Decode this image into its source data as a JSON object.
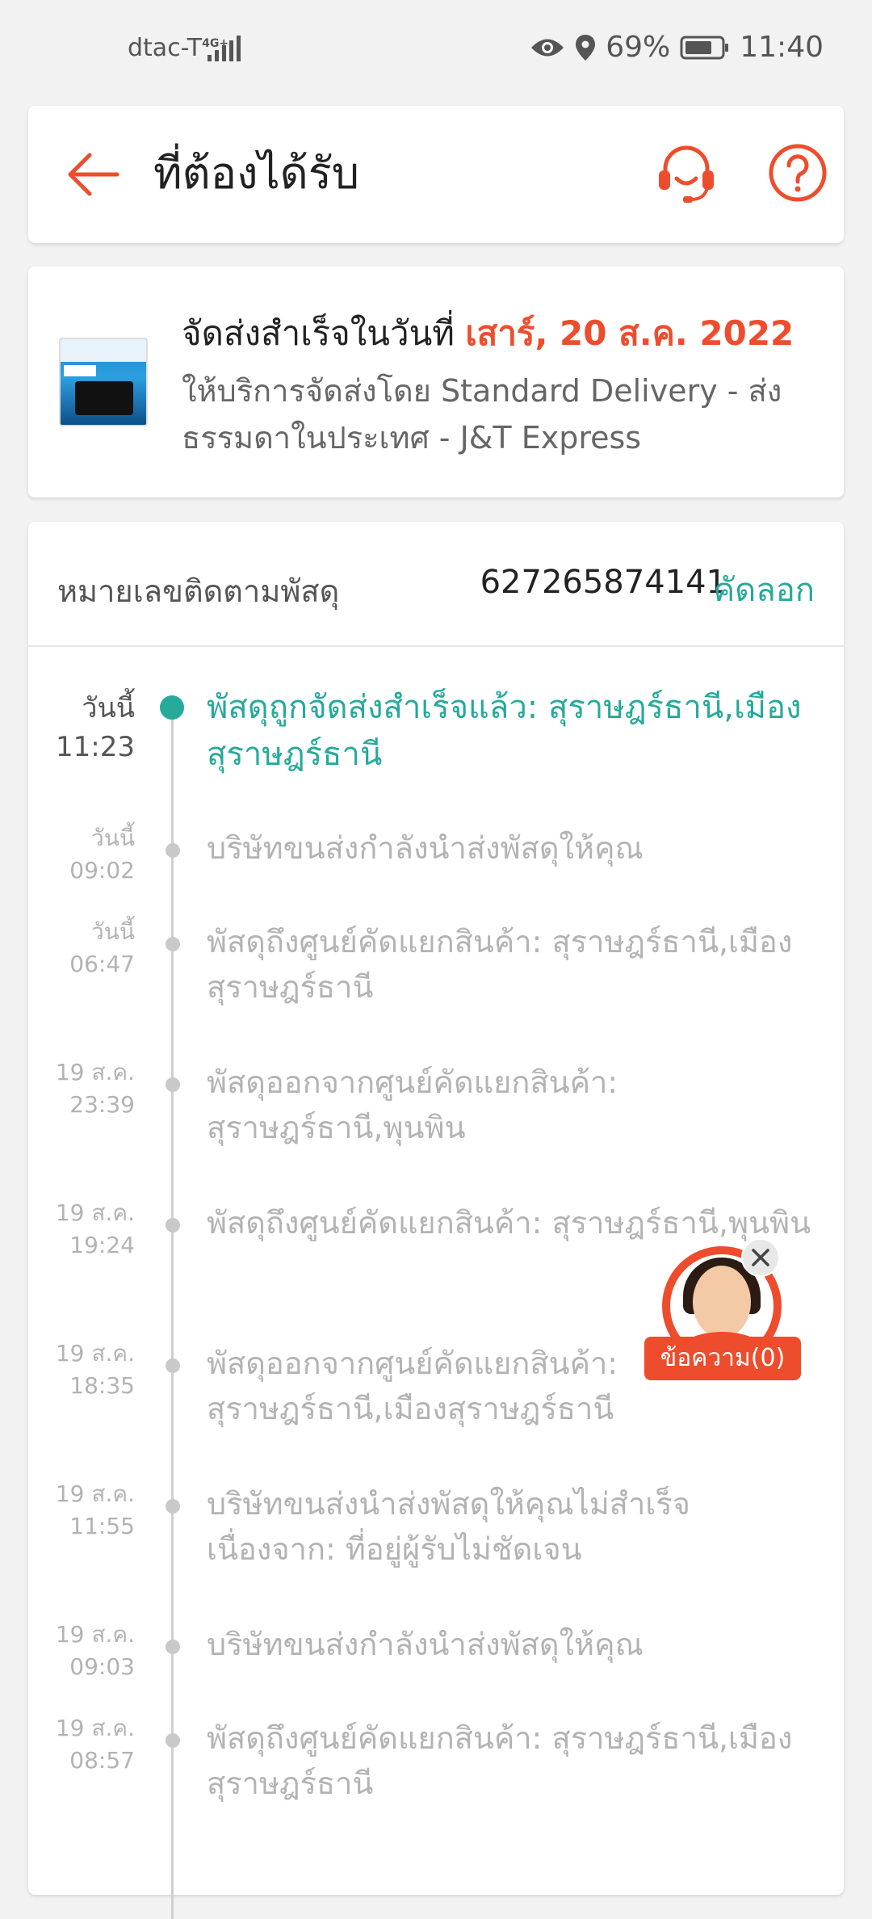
{
  "status_bar": {
    "carrier": "dtac-T",
    "network": "4G+",
    "battery": "69%",
    "time": "11:40",
    "icons": [
      "eye-icon",
      "location-icon",
      "battery-icon",
      "signal-icon"
    ]
  },
  "header": {
    "title": "ที่ต้องได้รับ",
    "back_icon": "back-arrow-icon",
    "support_icon": "headset-icon",
    "help_icon": "help-icon"
  },
  "delivery": {
    "status_prefix": "จัดส่งสำเร็จในวันที่ ",
    "date": "เสาร์, 20 ส.ค. 2022",
    "service": "ให้บริการจัดส่งโดย Standard Delivery - ส่งธรรมดาในประเทศ - J&T Express"
  },
  "tracking": {
    "label": "หมายเลขติดตามพัสดุ",
    "number": "627265874141",
    "copy_label": "คัดลอก",
    "events": [
      {
        "day": "วันนี้",
        "time": "11:23",
        "text": "พัสดุถูกจัดส่งสำเร็จแล้ว: สุราษฎร์ธานี,เมืองสุราษฎร์ธานี"
      },
      {
        "day": "วันนี้",
        "time": "09:02",
        "text": "บริษัทขนส่งกำลังนำส่งพัสดุให้คุณ"
      },
      {
        "day": "วันนี้",
        "time": "06:47",
        "text": "พัสดุถึงศูนย์คัดแยกสินค้า: สุราษฎร์ธานี,เมืองสุราษฎร์ธานี"
      },
      {
        "day": "19 ส.ค.",
        "time": "23:39",
        "text": "พัสดุออกจากศูนย์คัดแยกสินค้า: สุราษฎร์ธานี,พุนพิน"
      },
      {
        "day": "19 ส.ค.",
        "time": "19:24",
        "text": "พัสดุถึงศูนย์คัดแยกสินค้า: สุราษฎร์ธานี,พุนพิน"
      },
      {
        "day": "19 ส.ค.",
        "time": "18:35",
        "text": "พัสดุออกจากศูนย์คัดแยกสินค้า: สุราษฎร์ธานี,เมืองสุราษฎร์ธานี"
      },
      {
        "day": "19 ส.ค.",
        "time": "11:55",
        "text": "บริษัทขนส่งนำส่งพัสดุให้คุณไม่สำเร็จ เนื่องจาก: ที่อยู่ผู้รับไม่ชัดเจน"
      },
      {
        "day": "19 ส.ค.",
        "time": "09:03",
        "text": "บริษัทขนส่งกำลังนำส่งพัสดุให้คุณ"
      },
      {
        "day": "19 ส.ค.",
        "time": "08:57",
        "text": "พัสดุถึงศูนย์คัดแยกสินค้า: สุราษฎร์ธานี,เมืองสุราษฎร์ธานี"
      }
    ]
  },
  "chat": {
    "label": "ข้อความ(0)",
    "close_icon": "close-icon"
  },
  "colors": {
    "accent": "#ee4d2d",
    "success": "#26aa99",
    "muted": "#b3b3b3"
  }
}
